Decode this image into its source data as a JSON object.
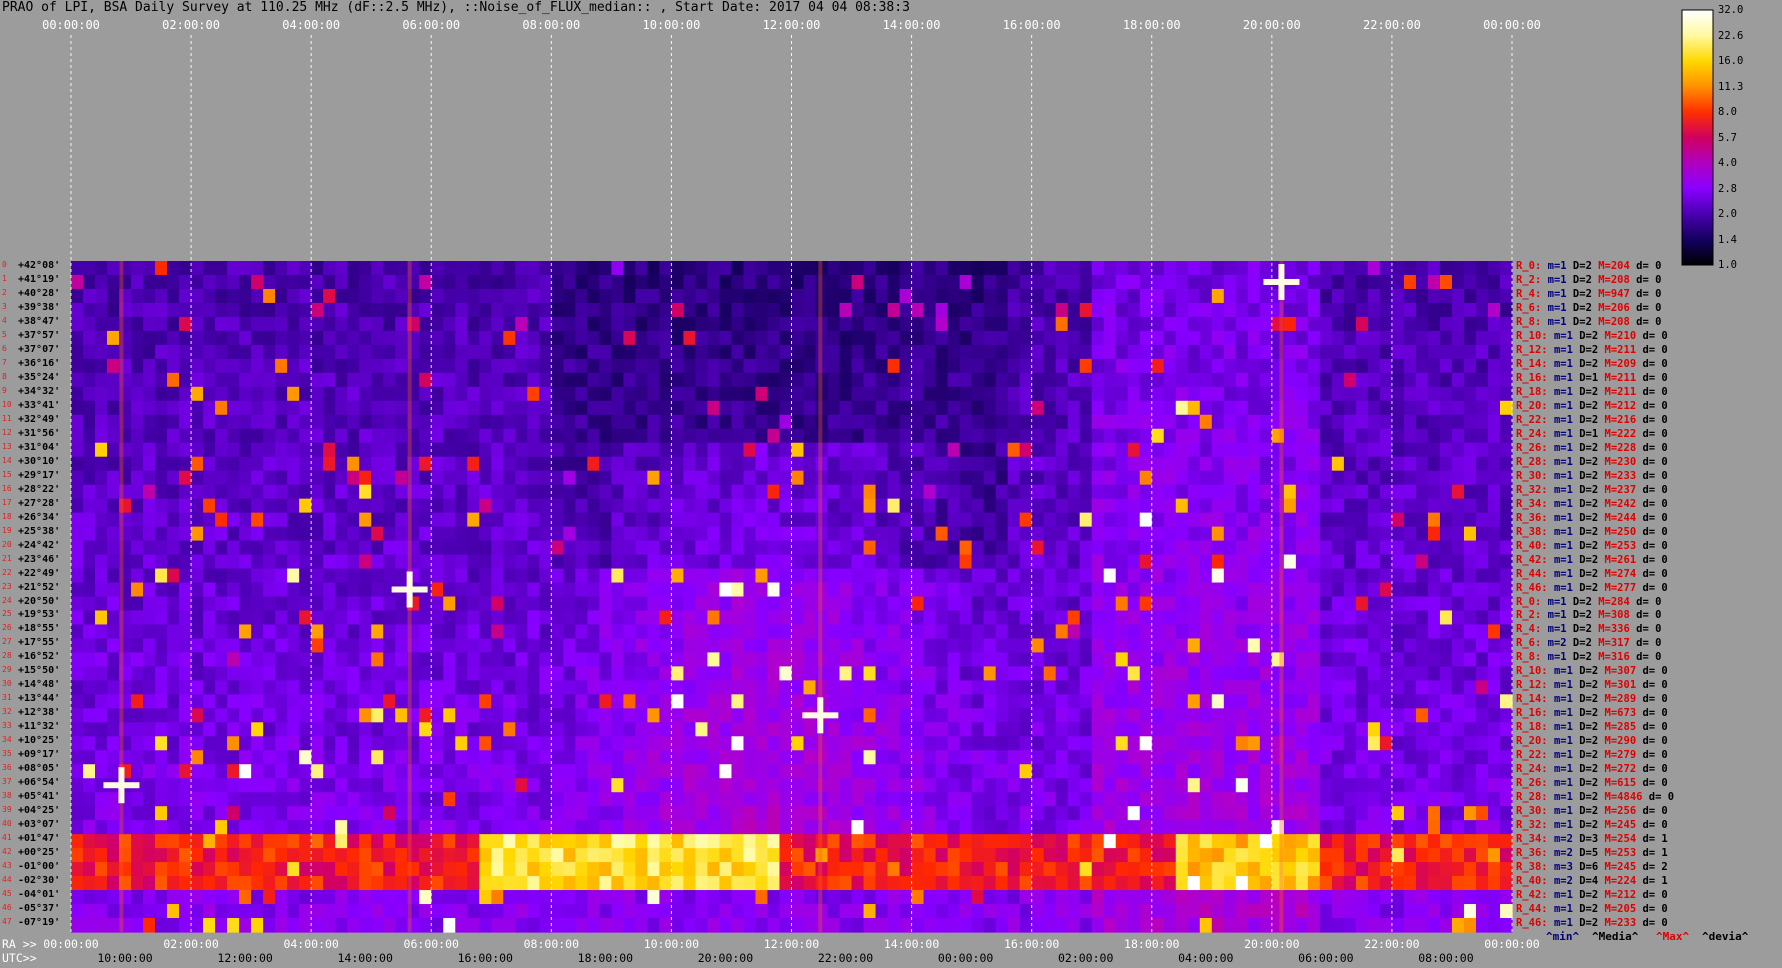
{
  "title": "PRAO of LPI, BSA Daily Survey at 110.25 MHz (dF::2.5 MHz), ::Noise_of_FLUX_median:: , Start Date: 2017 04 04 08:38:3",
  "chart_data": {
    "type": "heatmap",
    "title": "PRAO of LPI, BSA Daily Survey at 110.25 MHz (dF::2.5 MHz), ::Noise_of_FLUX_median:: , Start Date: 2017 04 04 08:38:3",
    "top_axis_ticks": [
      "00:00:00",
      "02:00:00",
      "04:00:00",
      "06:00:00",
      "08:00:00",
      "10:00:00",
      "12:00:00",
      "14:00:00",
      "16:00:00",
      "18:00:00",
      "20:00:00",
      "22:00:00",
      "00:00:00"
    ],
    "ra_axis_label": "RA >>",
    "ra_ticks": [
      "00:00:00",
      "02:00:00",
      "04:00:00",
      "06:00:00",
      "08:00:00",
      "10:00:00",
      "12:00:00",
      "14:00:00",
      "16:00:00",
      "18:00:00",
      "20:00:00",
      "22:00:00",
      "00:00:00"
    ],
    "utc_axis_label": "UTC>>",
    "utc_ticks": [
      "10:00:00",
      "12:00:00",
      "14:00:00",
      "16:00:00",
      "18:00:00",
      "20:00:00",
      "22:00:00",
      "00:00:00",
      "02:00:00",
      "04:00:00",
      "06:00:00",
      "08:00:00"
    ],
    "declinations": [
      "+42°08'",
      "+41°19'",
      "+40°28'",
      "+39°38'",
      "+38°47'",
      "+37°57'",
      "+37°07'",
      "+36°16'",
      "+35°24'",
      "+34°32'",
      "+33°41'",
      "+32°49'",
      "+31°56'",
      "+31°04'",
      "+30°10'",
      "+29°17'",
      "+28°22'",
      "+27°28'",
      "+26°34'",
      "+25°38'",
      "+24°42'",
      "+23°46'",
      "+22°49'",
      "+21°52'",
      "+20°50'",
      "+19°53'",
      "+18°55'",
      "+17°55'",
      "+16°52'",
      "+15°50'",
      "+14°48'",
      "+13°44'",
      "+12°38'",
      "+11°32'",
      "+10°25'",
      "+09°17'",
      "+08°05'",
      "+06°54'",
      "+05°41'",
      "+04°25'",
      "+03°07'",
      "+01°47'",
      "+00°25'",
      "-01°00'",
      "-02°30'",
      "-04°01'",
      "-05°37'",
      "-07°19'"
    ],
    "row_numbers": [
      "0",
      "1",
      "2",
      "3",
      "4",
      "5",
      "6",
      "7",
      "8",
      "9",
      "10",
      "11",
      "12",
      "13",
      "14",
      "15",
      "16",
      "17",
      "18",
      "19",
      "20",
      "21",
      "22",
      "23",
      "24",
      "25",
      "26",
      "27",
      "28",
      "29",
      "30",
      "31",
      "32",
      "33",
      "34",
      "35",
      "36",
      "37",
      "38",
      "39",
      "40",
      "41",
      "42",
      "43",
      "44",
      "45",
      "46",
      "47"
    ],
    "row_stats": [
      {
        "label": "R_0:",
        "m": "m=1",
        "d": "D=2",
        "max": "M=204",
        "dev": "d= 0"
      },
      {
        "label": "R_2:",
        "m": "m=1",
        "d": "D=2",
        "max": "M=208",
        "dev": "d= 0"
      },
      {
        "label": "R_4:",
        "m": "m=1",
        "d": "D=2",
        "max": "M=947",
        "dev": "d= 0"
      },
      {
        "label": "R_6:",
        "m": "m=1",
        "d": "D=2",
        "max": "M=206",
        "dev": "d= 0"
      },
      {
        "label": "R_8:",
        "m": "m=1",
        "d": "D=2",
        "max": "M=208",
        "dev": "d= 0"
      },
      {
        "label": "R_10:",
        "m": "m=1",
        "d": "D=2",
        "max": "M=210",
        "dev": "d= 0"
      },
      {
        "label": "R_12:",
        "m": "m=1",
        "d": "D=2",
        "max": "M=211",
        "dev": "d= 0"
      },
      {
        "label": "R_14:",
        "m": "m=1",
        "d": "D=2",
        "max": "M=209",
        "dev": "d= 0"
      },
      {
        "label": "R_16:",
        "m": "m=1",
        "d": "D=1",
        "max": "M=211",
        "dev": "d= 0"
      },
      {
        "label": "R_18:",
        "m": "m=1",
        "d": "D=2",
        "max": "M=211",
        "dev": "d= 0"
      },
      {
        "label": "R_20:",
        "m": "m=1",
        "d": "D=2",
        "max": "M=212",
        "dev": "d= 0"
      },
      {
        "label": "R_22:",
        "m": "m=1",
        "d": "D=2",
        "max": "M=216",
        "dev": "d= 0"
      },
      {
        "label": "R_24:",
        "m": "m=1",
        "d": "D=1",
        "max": "M=222",
        "dev": "d= 0"
      },
      {
        "label": "R_26:",
        "m": "m=1",
        "d": "D=2",
        "max": "M=228",
        "dev": "d= 0"
      },
      {
        "label": "R_28:",
        "m": "m=1",
        "d": "D=2",
        "max": "M=230",
        "dev": "d= 0"
      },
      {
        "label": "R_30:",
        "m": "m=1",
        "d": "D=2",
        "max": "M=233",
        "dev": "d= 0"
      },
      {
        "label": "R_32:",
        "m": "m=1",
        "d": "D=2",
        "max": "M=237",
        "dev": "d= 0"
      },
      {
        "label": "R_34:",
        "m": "m=1",
        "d": "D=2",
        "max": "M=242",
        "dev": "d= 0"
      },
      {
        "label": "R_36:",
        "m": "m=1",
        "d": "D=2",
        "max": "M=244",
        "dev": "d= 0"
      },
      {
        "label": "R_38:",
        "m": "m=1",
        "d": "D=2",
        "max": "M=250",
        "dev": "d= 0"
      },
      {
        "label": "R_40:",
        "m": "m=1",
        "d": "D=2",
        "max": "M=253",
        "dev": "d= 0"
      },
      {
        "label": "R_42:",
        "m": "m=1",
        "d": "D=2",
        "max": "M=261",
        "dev": "d= 0"
      },
      {
        "label": "R_44:",
        "m": "m=1",
        "d": "D=2",
        "max": "M=274",
        "dev": "d= 0"
      },
      {
        "label": "R_46:",
        "m": "m=1",
        "d": "D=2",
        "max": "M=277",
        "dev": "d= 0"
      },
      {
        "label": "R_0:",
        "m": "m=1",
        "d": "D=2",
        "max": "M=284",
        "dev": "d= 0"
      },
      {
        "label": "R_2:",
        "m": "m=1",
        "d": "D=2",
        "max": "M=308",
        "dev": "d= 0"
      },
      {
        "label": "R_4:",
        "m": "m=1",
        "d": "D=2",
        "max": "M=336",
        "dev": "d= 0"
      },
      {
        "label": "R_6:",
        "m": "m=2",
        "d": "D=2",
        "max": "M=317",
        "dev": "d= 0"
      },
      {
        "label": "R_8:",
        "m": "m=1",
        "d": "D=2",
        "max": "M=316",
        "dev": "d= 0"
      },
      {
        "label": "R_10:",
        "m": "m=1",
        "d": "D=2",
        "max": "M=307",
        "dev": "d= 0"
      },
      {
        "label": "R_12:",
        "m": "m=1",
        "d": "D=2",
        "max": "M=301",
        "dev": "d= 0"
      },
      {
        "label": "R_14:",
        "m": "m=1",
        "d": "D=2",
        "max": "M=289",
        "dev": "d= 0"
      },
      {
        "label": "R_16:",
        "m": "m=1",
        "d": "D=2",
        "max": "M=673",
        "dev": "d= 0"
      },
      {
        "label": "R_18:",
        "m": "m=1",
        "d": "D=2",
        "max": "M=285",
        "dev": "d= 0"
      },
      {
        "label": "R_20:",
        "m": "m=1",
        "d": "D=2",
        "max": "M=290",
        "dev": "d= 0"
      },
      {
        "label": "R_22:",
        "m": "m=1",
        "d": "D=2",
        "max": "M=279",
        "dev": "d= 0"
      },
      {
        "label": "R_24:",
        "m": "m=1",
        "d": "D=2",
        "max": "M=272",
        "dev": "d= 0"
      },
      {
        "label": "R_26:",
        "m": "m=1",
        "d": "D=2",
        "max": "M=615",
        "dev": "d= 0"
      },
      {
        "label": "R_28:",
        "m": "m=1",
        "d": "D=2",
        "max": "M=4846",
        "dev": "d= 0"
      },
      {
        "label": "R_30:",
        "m": "m=1",
        "d": "D=2",
        "max": "M=256",
        "dev": "d= 0"
      },
      {
        "label": "R_32:",
        "m": "m=1",
        "d": "D=2",
        "max": "M=245",
        "dev": "d= 0"
      },
      {
        "label": "R_34:",
        "m": "m=2",
        "d": "D=3",
        "max": "M=254",
        "dev": "d= 1"
      },
      {
        "label": "R_36:",
        "m": "m=2",
        "d": "D=5",
        "max": "M=253",
        "dev": "d= 1"
      },
      {
        "label": "R_38:",
        "m": "m=3",
        "d": "D=6",
        "max": "M=245",
        "dev": "d= 2"
      },
      {
        "label": "R_40:",
        "m": "m=2",
        "d": "D=4",
        "max": "M=224",
        "dev": "d= 1"
      },
      {
        "label": "R_42:",
        "m": "m=1",
        "d": "D=2",
        "max": "M=212",
        "dev": "d= 0"
      },
      {
        "label": "R_44:",
        "m": "m=1",
        "d": "D=2",
        "max": "M=205",
        "dev": "d= 0"
      },
      {
        "label": "R_46:",
        "m": "m=1",
        "d": "D=2",
        "max": "M=233",
        "dev": "d= 0"
      }
    ],
    "colorbar_ticks": [
      "32.0",
      "22.6",
      "16.0",
      "11.3",
      "8.0",
      "5.7",
      "4.0",
      "2.8",
      "2.0",
      "1.4",
      "1.0"
    ],
    "colorbar_values": [
      32.0,
      22.6,
      16.0,
      11.3,
      8.0,
      5.7,
      4.0,
      2.8,
      2.0,
      1.4,
      1.0
    ],
    "colorbar_colors": [
      "#ffffff",
      "#fff9a0",
      "#ffd800",
      "#ff9000",
      "#ff3000",
      "#d00060",
      "#b000c0",
      "#8a00ff",
      "#4a00b0",
      "#140060",
      "#000000"
    ],
    "footer_keys": [
      {
        "text": "^min^",
        "color": "#00007a"
      },
      {
        "text": "^Media^",
        "color": "#000000"
      },
      {
        "text": "^Max^",
        "color": "#e00000"
      },
      {
        "text": "^devia^",
        "color": "#000000"
      }
    ]
  }
}
